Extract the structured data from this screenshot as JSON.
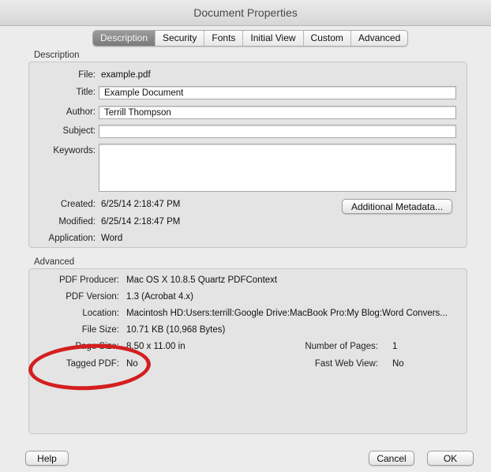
{
  "window": {
    "title": "Document Properties"
  },
  "tabs": [
    {
      "label": "Description",
      "selected": true
    },
    {
      "label": "Security",
      "selected": false
    },
    {
      "label": "Fonts",
      "selected": false
    },
    {
      "label": "Initial View",
      "selected": false
    },
    {
      "label": "Custom",
      "selected": false
    },
    {
      "label": "Advanced",
      "selected": false
    }
  ],
  "description": {
    "section_label": "Description",
    "file_label": "File:",
    "file_value": "example.pdf",
    "title_label": "Title:",
    "title_value": "Example Document",
    "author_label": "Author:",
    "author_value": "Terrill Thompson",
    "subject_label": "Subject:",
    "subject_value": "",
    "keywords_label": "Keywords:",
    "keywords_value": "",
    "created_label": "Created:",
    "created_value": "6/25/14 2:18:47 PM",
    "modified_label": "Modified:",
    "modified_value": "6/25/14 2:18:47 PM",
    "application_label": "Application:",
    "application_value": "Word",
    "additional_metadata_button": "Additional Metadata..."
  },
  "advanced": {
    "section_label": "Advanced",
    "producer_label": "PDF Producer:",
    "producer_value": "Mac OS X 10.8.5 Quartz PDFContext",
    "version_label": "PDF Version:",
    "version_value": "1.3 (Acrobat 4.x)",
    "location_label": "Location:",
    "location_value": "Macintosh HD:Users:terrill:Google Drive:MacBook Pro:My Blog:Word Convers...",
    "filesize_label": "File Size:",
    "filesize_value": "10.71 KB (10,968 Bytes)",
    "pagesize_label": "Page Size:",
    "pagesize_value": "8.50 x 11.00 in",
    "numpages_label": "Number of Pages:",
    "numpages_value": "1",
    "tagged_label": "Tagged PDF:",
    "tagged_value": "No",
    "fastweb_label": "Fast Web View:",
    "fastweb_value": "No"
  },
  "buttons": {
    "help": "Help",
    "cancel": "Cancel",
    "ok": "OK"
  },
  "annotation": {
    "color": "#d41f20"
  }
}
